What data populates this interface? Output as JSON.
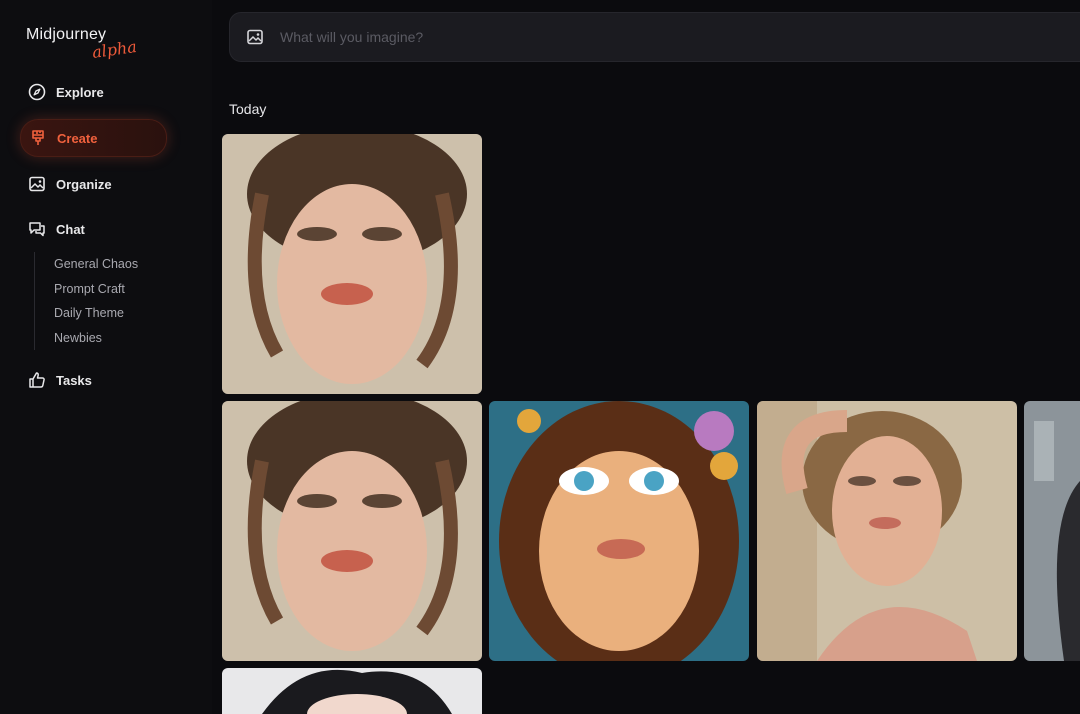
{
  "app": {
    "name": "Midjourney",
    "edition": "alpha"
  },
  "nav": {
    "explore": "Explore",
    "create": "Create",
    "organize": "Organize",
    "chat": "Chat",
    "chat_channels": [
      "General Chaos",
      "Prompt Craft",
      "Daily Theme",
      "Newbies"
    ],
    "tasks": "Tasks"
  },
  "search": {
    "placeholder": "What will you imagine?"
  },
  "gallery": {
    "section_title": "Today"
  },
  "colors": {
    "accent": "#ee5a3a",
    "background": "#0b0b0e"
  }
}
